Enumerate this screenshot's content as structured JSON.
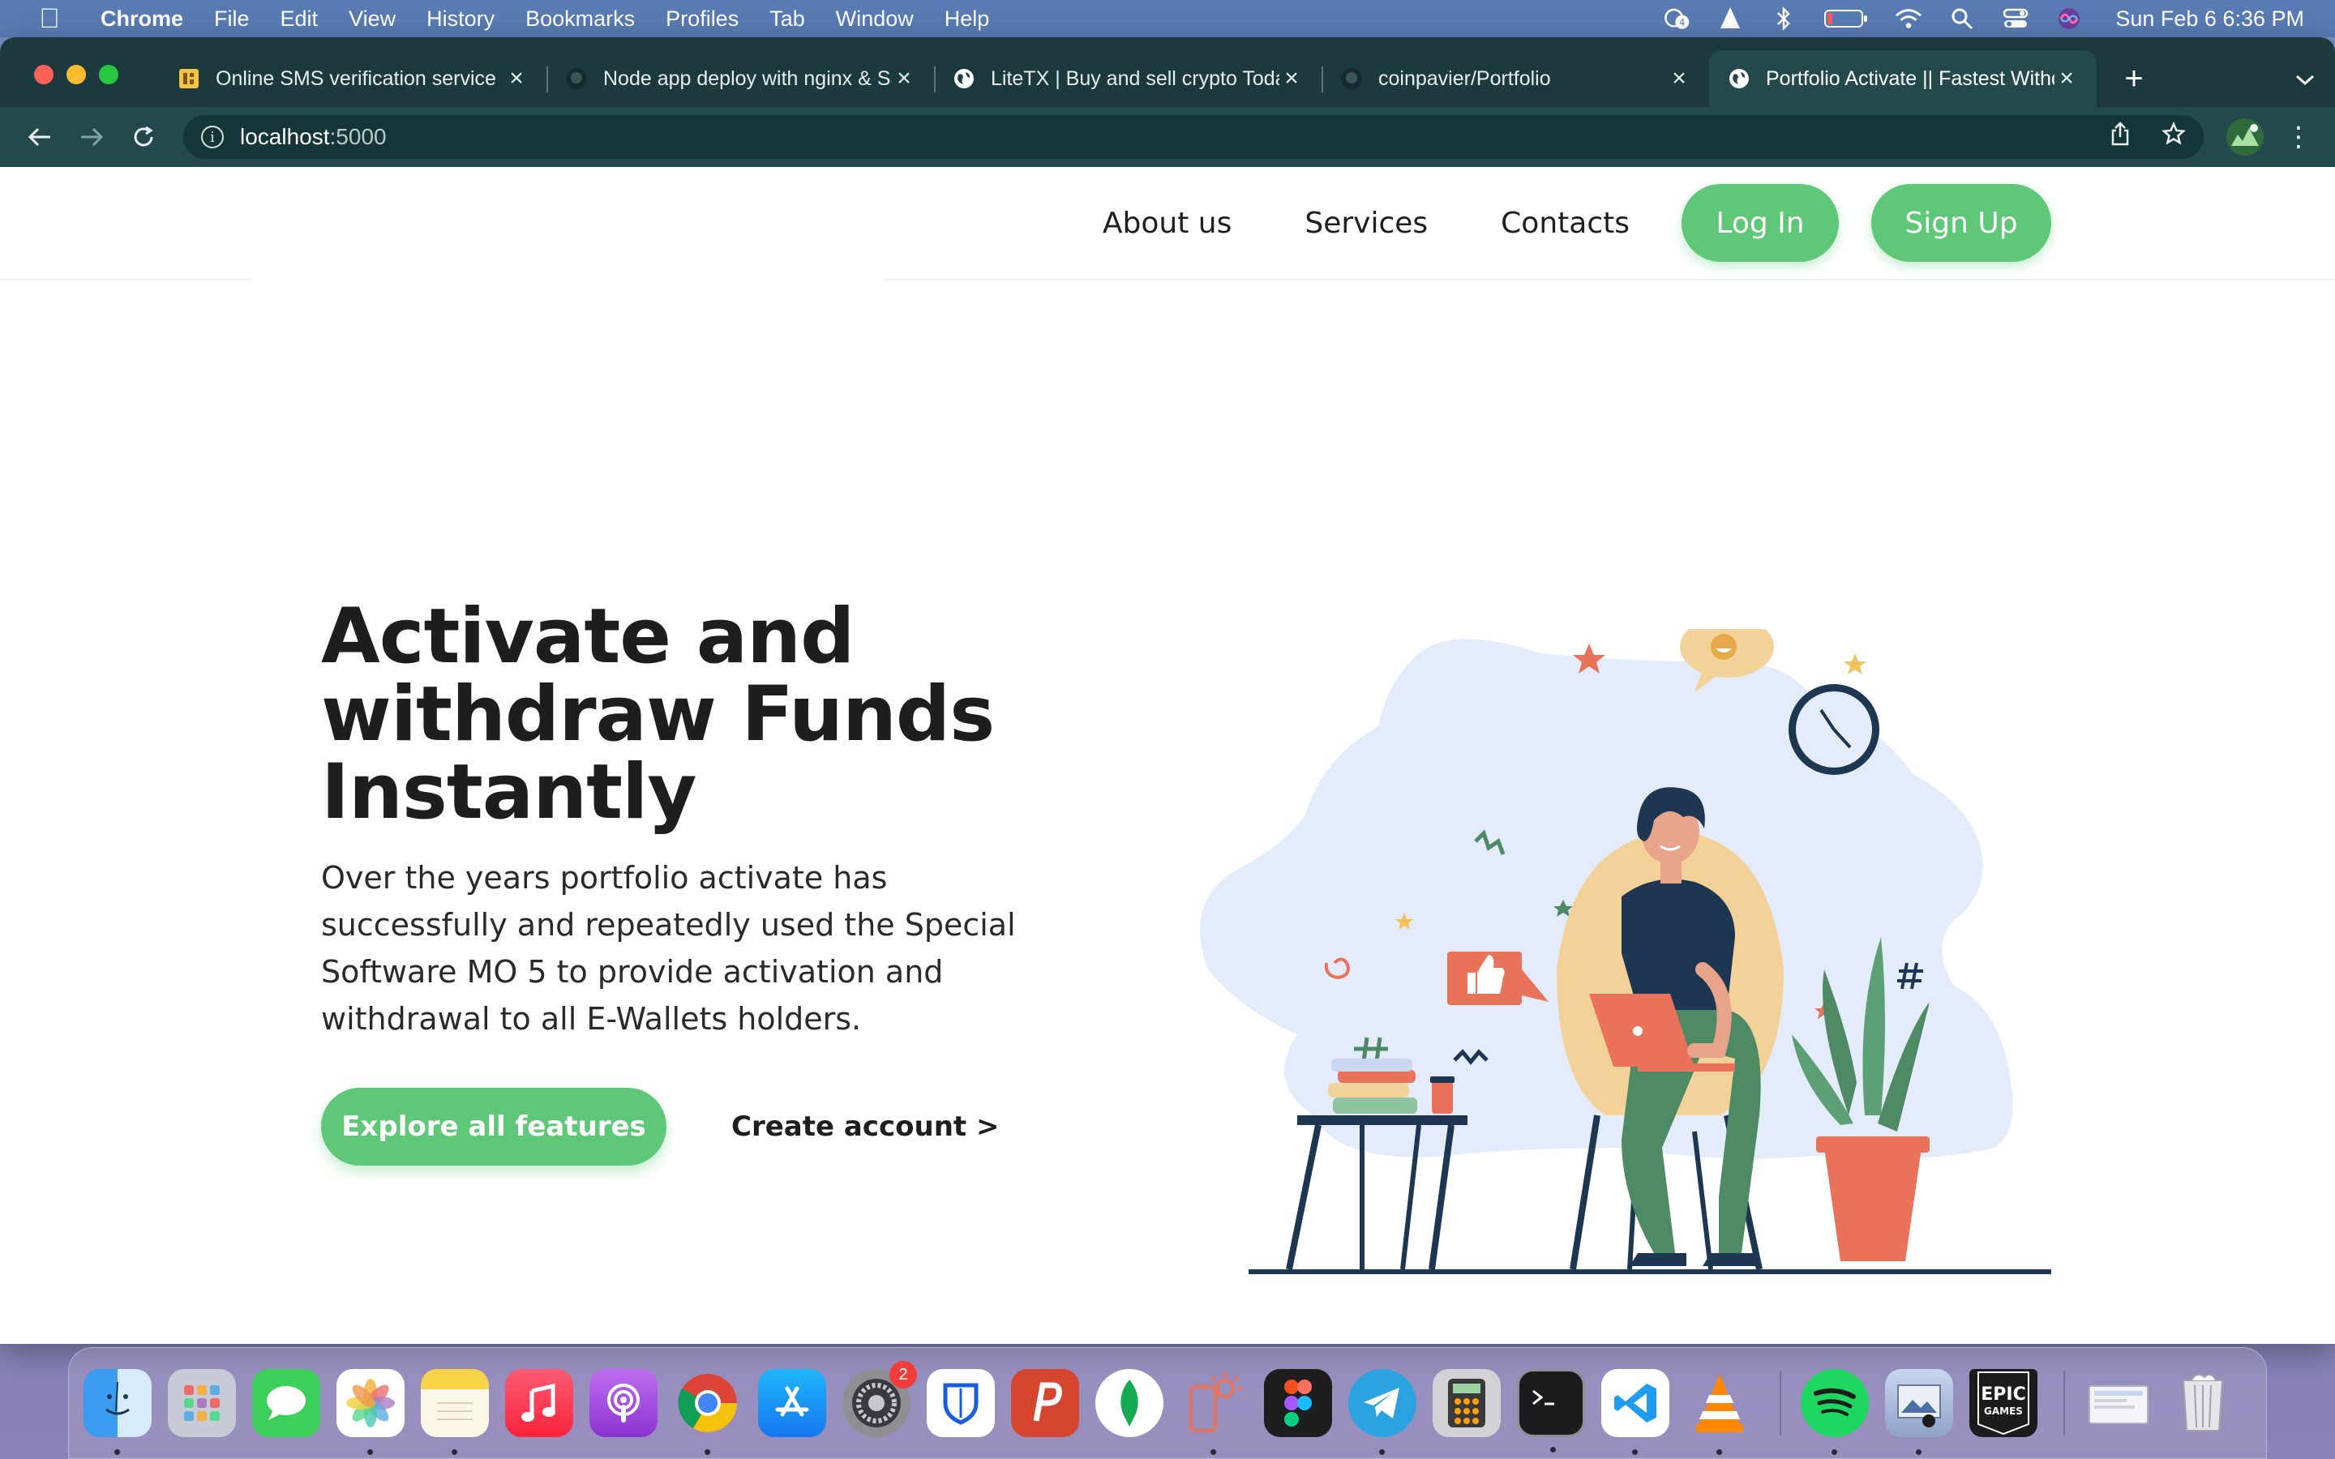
{
  "menubar": {
    "app_name": "Chrome",
    "menus": [
      "File",
      "Edit",
      "View",
      "History",
      "Bookmarks",
      "Profiles",
      "Tab",
      "Window",
      "Help"
    ],
    "clock": "Sun Feb 6  6:36 PM",
    "notification_count": "4"
  },
  "browser": {
    "tabs": [
      {
        "title": "Online SMS verification service",
        "icon": "sms-service-icon"
      },
      {
        "title": "Node app deploy with nginx & SSL",
        "icon": "github-icon"
      },
      {
        "title": "LiteTX | Buy and sell crypto Today",
        "icon": "globe-icon"
      },
      {
        "title": "coinpavier/Portfolio",
        "icon": "github-icon"
      },
      {
        "title": "Portfolio Activate || Fastest Withdrawal",
        "icon": "globe-icon",
        "active": true
      }
    ],
    "url_host": "localhost",
    "url_port": ":5000"
  },
  "site": {
    "nav": {
      "about": "About us",
      "services": "Services",
      "contacts": "Contacts",
      "login": "Log In",
      "signup": "Sign Up"
    },
    "hero": {
      "title_line1": "Activate and",
      "title_line2": "withdraw Funds",
      "title_line3": "Instantly",
      "description": "Over the years portfolio activate has successfully and repeatedly used the Special Software MO 5 to provide activation and withdrawal to all E-Wallets holders.",
      "cta_primary": "Explore all features",
      "cta_secondary": "Create account >"
    },
    "colors": {
      "accent": "#5ec878",
      "text": "#1e1e1e",
      "illustration_blob": "#e4ebfb",
      "illustration_orange": "#e8735a",
      "illustration_navy": "#1d3652",
      "illustration_green": "#4e8a64"
    }
  },
  "dock": {
    "apps": [
      "Finder",
      "Launchpad",
      "Messages",
      "Photos",
      "Notes",
      "Music",
      "Podcasts",
      "Chrome",
      "App Store",
      "System Preferences",
      "Bitwarden",
      "Postman",
      "MongoDB Compass",
      "Simulator",
      "Figma",
      "Telegram",
      "Calculator",
      "Terminal",
      "VS Code",
      "VLC",
      "Spotify",
      "Preview",
      "Epic Games",
      "Downloads",
      "Trash"
    ],
    "system_prefs_badge": "2",
    "epic_label_1": "EPIC",
    "epic_label_2": "GAMES"
  }
}
